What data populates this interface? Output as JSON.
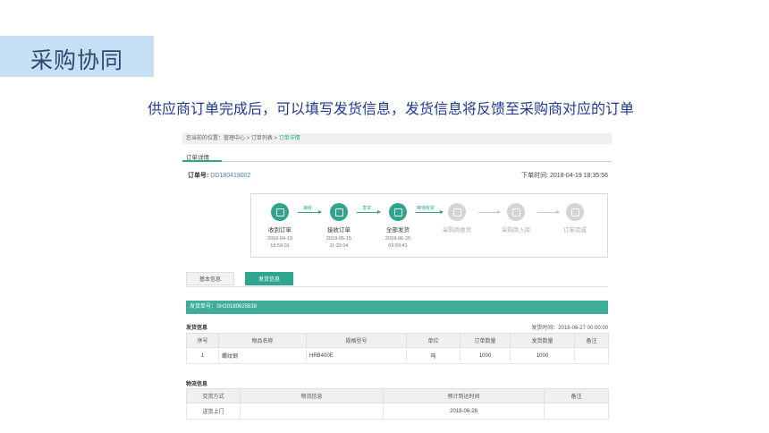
{
  "slide": {
    "title": "采购协同",
    "subtitle": "供应商订单完成后，可以填写发货信息，发货信息将反馈至采购商对应的订单"
  },
  "breadcrumb": {
    "prefix": "您当前的位置：管理中心 > 订单列表 > ",
    "current": "订单详情"
  },
  "detail_tab": "订单详情",
  "order": {
    "no_label": "订单号:",
    "no_value": "DD180419002",
    "time_label": "下单时间:",
    "time_value": "2018-04-19 18:35:56"
  },
  "steps": [
    {
      "label": "收到订单",
      "date": "2018-04-19",
      "time": "18:59:01",
      "done": true
    },
    {
      "label": "接收订单",
      "date": "2018-05-15",
      "time": "11:32:04",
      "done": true
    },
    {
      "label": "全部发货",
      "date": "2018-06-25",
      "time": "09:59:41",
      "done": true
    },
    {
      "label": "采购商收货",
      "date": "",
      "time": "",
      "done": false
    },
    {
      "label": "采购商入库",
      "date": "",
      "time": "",
      "done": false
    },
    {
      "label": "订单完成",
      "date": "",
      "time": "",
      "done": false
    }
  ],
  "arrow_labels": [
    "接收",
    "发货",
    "等待收货"
  ],
  "info_tabs": {
    "basic": "基本信息",
    "ship": "发货信息"
  },
  "shipment": {
    "no_label": "发货单号：",
    "no_value": "SH20180625838",
    "section": "发货信息",
    "time_label": "发货时间：",
    "time_value": "2018-06-27 00:00:00"
  },
  "goods_table": {
    "headers": [
      "序号",
      "物品名称",
      "规格型号",
      "单位",
      "订单数量",
      "发货数量",
      "备注"
    ],
    "rows": [
      [
        "1",
        "螺纹钢",
        "HRB400E",
        "吨",
        "1000",
        "1000",
        ""
      ]
    ]
  },
  "logistics": {
    "section": "物流信息",
    "headers": [
      "交货方式",
      "物流信息",
      "预计到达时间",
      "备注"
    ],
    "rows": [
      [
        "送货上门",
        "",
        "2018-06-28",
        ""
      ]
    ]
  },
  "colors": {
    "accent": "#2fa58e",
    "title_bg": "#c6dff5",
    "subtitle": "#1f3b8f"
  }
}
